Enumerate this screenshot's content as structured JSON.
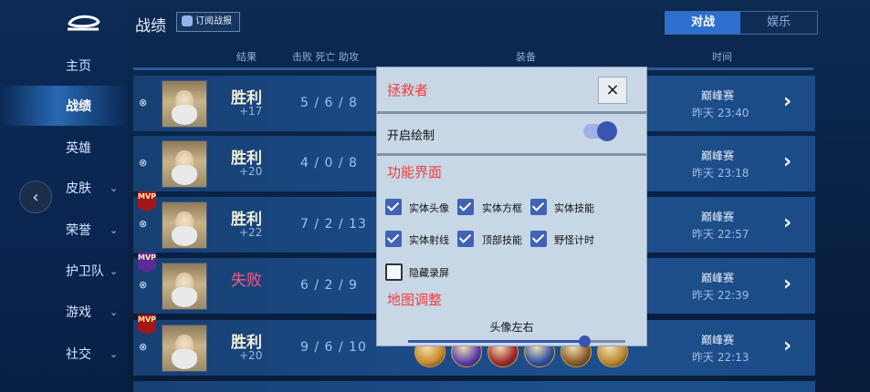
{
  "sidebar": {
    "items": [
      {
        "label": "主页",
        "chevron": false,
        "active": false
      },
      {
        "label": "战绩",
        "chevron": false,
        "active": true
      },
      {
        "label": "英雄",
        "chevron": false,
        "active": false
      },
      {
        "label": "皮肤",
        "chevron": true,
        "active": false
      },
      {
        "label": "荣誉",
        "chevron": true,
        "active": false
      },
      {
        "label": "护卫队",
        "chevron": true,
        "active": false
      },
      {
        "label": "游戏",
        "chevron": true,
        "active": false
      },
      {
        "label": "社交",
        "chevron": true,
        "active": false
      }
    ],
    "collapse_glyph": "‹"
  },
  "header": {
    "title": "战绩",
    "subscribe_label": "订阅战报",
    "tabs": [
      {
        "label": "对战",
        "active": true
      },
      {
        "label": "娱乐",
        "active": false
      }
    ]
  },
  "columns": {
    "result": "结果",
    "kda": "击败 死亡 助攻",
    "equipment": "装备",
    "time": "时间"
  },
  "rows": [
    {
      "mvp": false,
      "result": "胜利",
      "delta": "+17",
      "kda": "5 / 6 / 8",
      "mode": "巅峰赛",
      "time": "昨天 23:40"
    },
    {
      "mvp": false,
      "result": "胜利",
      "delta": "+20",
      "kda": "4 / 0 / 8",
      "mode": "巅峰赛",
      "time": "昨天 23:18"
    },
    {
      "mvp": true,
      "mvp_color": "red",
      "result": "胜利",
      "delta": "+22",
      "kda": "7 / 2 / 13",
      "mode": "巅峰赛",
      "time": "昨天 22:57"
    },
    {
      "mvp": true,
      "mvp_color": "purple",
      "result": "失败",
      "delta": "",
      "kda": "6 / 2 / 9",
      "mode": "巅峰赛",
      "time": "昨天 22:39"
    },
    {
      "mvp": true,
      "mvp_color": "red",
      "result": "胜利",
      "delta": "+20",
      "kda": "9 / 6 / 10",
      "mode": "巅峰赛",
      "time": "昨天 22:13"
    }
  ],
  "mvp_text": "MVP",
  "link_glyph": "⊗",
  "arrow_glyph": "›",
  "item_colors": [
    "#c98a2b",
    "#5b3aa8",
    "#a0282d",
    "#2f4fa0",
    "#8a5a2a",
    "#b8892f"
  ],
  "panel": {
    "title": "拯救者",
    "close_glyph": "×",
    "draw_toggle_label": "开启绘制",
    "draw_toggle_on": true,
    "features_heading": "功能界面",
    "checkboxes": [
      {
        "label": "实体头像",
        "checked": true
      },
      {
        "label": "实体方框",
        "checked": true
      },
      {
        "label": "实体技能",
        "checked": true
      },
      {
        "label": "实体射线",
        "checked": true
      },
      {
        "label": "顶部技能",
        "checked": true
      },
      {
        "label": "野怪计时",
        "checked": true
      },
      {
        "label": "隐藏录屏",
        "checked": false
      }
    ],
    "map_heading": "地图调整",
    "slider_label": "头像左右",
    "slider_value": 0.81
  },
  "colors": {
    "accent": "#2d6fcf",
    "panel_title": "#ee3f3f",
    "lose": "#ff5a8a"
  }
}
